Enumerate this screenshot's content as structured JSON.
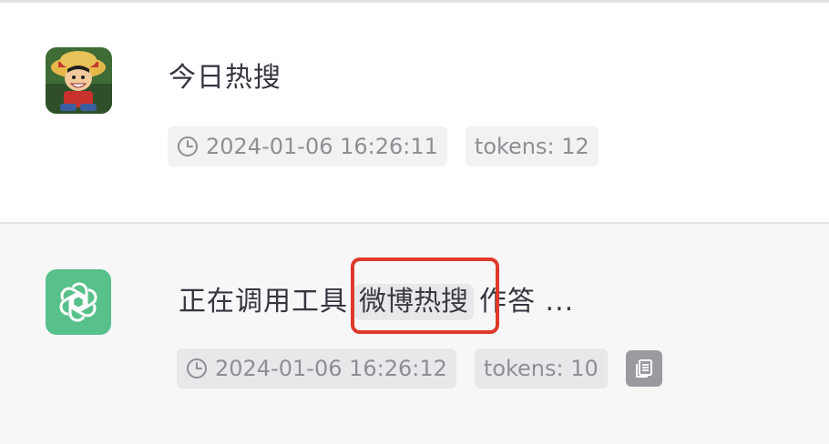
{
  "user_message": {
    "avatar": "luffy-avatar",
    "text": "今日热搜",
    "timestamp": "2024-01-06 16:26:11",
    "tokens": "tokens: 12"
  },
  "bot_message": {
    "avatar": "openai-logo-icon",
    "avatar_color": "#58c08b",
    "text_before": "正在调用工具",
    "tool_name": "微博热搜",
    "text_after": "作答 ...",
    "timestamp": "2024-01-06 16:26:12",
    "tokens": "tokens: 10",
    "copy_icon": "copy-icon"
  },
  "highlight_color": "#dd3a2a"
}
